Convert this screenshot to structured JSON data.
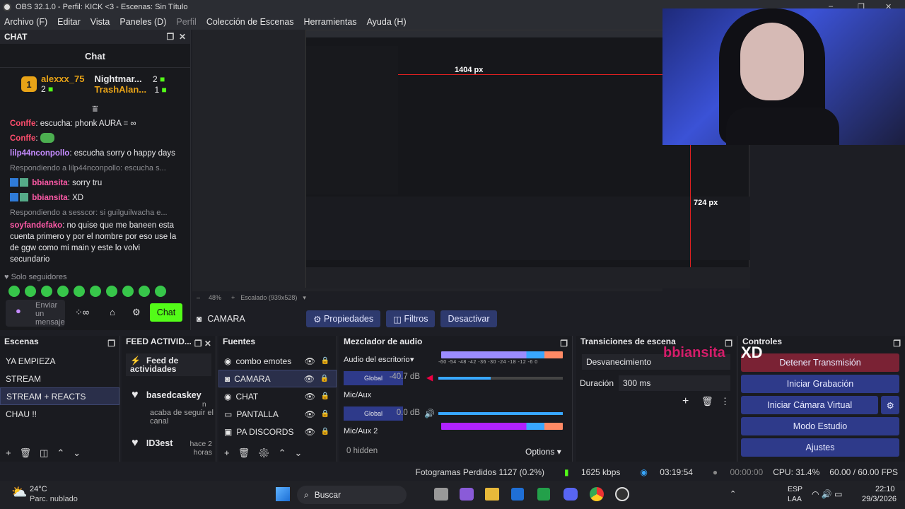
{
  "window": {
    "title": "OBS 32.1.0 - Perfil: KICK <3 - Escenas: Sin Título",
    "min": "–",
    "max": "❐",
    "close": "✕"
  },
  "menu": [
    "Archivo (F)",
    "Editar",
    "Vista",
    "Paneles (D)",
    "Perfil",
    "Colección de Escenas",
    "Herramientas",
    "Ayuda (H)"
  ],
  "chat": {
    "dock_title": "CHAT",
    "title": "Chat",
    "leaders": [
      {
        "rank": "1",
        "name": "alexxx_75",
        "count": "2"
      },
      {
        "rank": "",
        "name": "Nightmar...",
        "count": "2"
      },
      {
        "rank": "",
        "name": "TrashAlan...",
        "count": "1"
      }
    ],
    "leader_extra": "2",
    "messages": [
      {
        "user": "Conffe",
        "text": ": escucha: phonk AURA = ∞"
      },
      {
        "user": "Conffe",
        "text": ":"
      },
      {
        "user": "lilp44nconpollo",
        "text": ": escucha sorry o happy days"
      },
      {
        "reply": "Respondiendo a lilp44nconpollo: escucha s..."
      },
      {
        "user": "bbiansita",
        "text": ": sorry tru"
      },
      {
        "user": "bbiansita",
        "text": ": XD"
      },
      {
        "reply": "Respondiendo a sesscor: si guilguilwacha e..."
      },
      {
        "user": "soyfandefako",
        "text": ": no quise que me baneen esta cuenta primero y por el nombre por eso use la de ggw como mi main y este lo volvi secundario"
      }
    ],
    "followers_only": "Solo seguidores",
    "input_placeholder": "Enviar un mensaje",
    "send": "Chat"
  },
  "preview": {
    "zoom": "48%",
    "scale": "Escalado (939x528)",
    "label_px1": "1404 px",
    "label_px2": "724 px"
  },
  "source_toolbar": {
    "source": "CAMARA",
    "props": "Propiedades",
    "filters": "Filtros",
    "deactivate": "Desactivar"
  },
  "scenes": {
    "title": "Escenas",
    "items": [
      "YA EMPIEZA",
      "STREAM",
      "STREAM + REACTS",
      "CHAU !!"
    ]
  },
  "feed": {
    "title": "FEED ACTIVID...",
    "header": "Feed de actividades",
    "entries": [
      {
        "name": "basedcaskey",
        "sub": "acaba de seguir el canal",
        "time": "n"
      },
      {
        "name": "ID3est",
        "sub": "",
        "time": "hace 2 horas"
      }
    ]
  },
  "sources": {
    "title": "Fuentes",
    "items": [
      "combo emotes",
      "CAMARA",
      "CHAT",
      "PANTALLA",
      "PA DISCORDS"
    ]
  },
  "mixer": {
    "title": "Mezclador de audio",
    "channels": [
      {
        "name": "Audio del escritorio",
        "mode": "Global",
        "db": "-40.7 dB",
        "level": 0.42
      },
      {
        "name": "Mic/Aux",
        "mode": "Global",
        "db": "0.0 dB",
        "level": 1.0
      },
      {
        "name": "Mic/Aux 2",
        "mode": "",
        "db": "",
        "level": 0
      }
    ],
    "scale": "-60 -54 -48 -42 -36 -30 -24 -18 -12 -6 0",
    "hidden": "0 hidden",
    "options": "Options"
  },
  "transitions": {
    "title": "Transiciones de escena",
    "type": "Desvanecimiento",
    "duration_label": "Duración",
    "duration": "300 ms"
  },
  "controls": {
    "title": "Controles",
    "buttons": [
      "Detener Transmisión",
      "Iniciar Grabación",
      "Iniciar Cámara Virtual",
      "Modo Estudio",
      "Ajustes"
    ]
  },
  "overlay": {
    "name": "bbiansita",
    "text": "XD"
  },
  "status": {
    "dropped": "Fotogramas Perdidos 1127 (0.2%)",
    "kbps": "1625 kbps",
    "stream_time": "03:19:54",
    "rec_time": "00:00:00",
    "cpu": "CPU: 31.4%",
    "fps": "60.00 / 60.00 FPS"
  },
  "taskbar": {
    "temp": "24°C",
    "weather": "Parc. nublado",
    "search": "Buscar",
    "lang1": "ESP",
    "lang2": "LAA",
    "time": "22:10",
    "date": "29/3/2026"
  },
  "colors": {
    "accent": "#2e3a8a",
    "kick_green": "#53fc18",
    "stop_red": "#7a2234"
  }
}
